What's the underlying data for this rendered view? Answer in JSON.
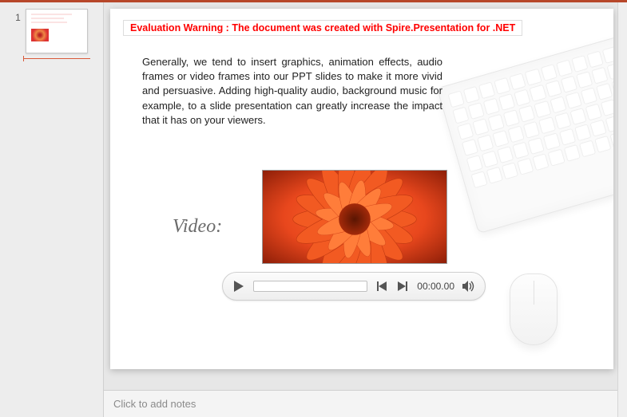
{
  "thumbnails": {
    "items": [
      {
        "number": "1"
      }
    ]
  },
  "slide": {
    "eval_warning": "Evaluation Warning : The document was created with  Spire.Presentation for .NET",
    "paragraph": "Generally, we tend to insert graphics, animation effects, audio frames or video frames into our PPT slides to make it more vivid and persuasive. Adding high-quality audio, background music for example, to a slide presentation can greatly increase the impact that it has on your viewers.",
    "video_label": "Video:",
    "player": {
      "timecode": "00:00.00"
    }
  },
  "notes": {
    "placeholder": "Click to add notes"
  }
}
